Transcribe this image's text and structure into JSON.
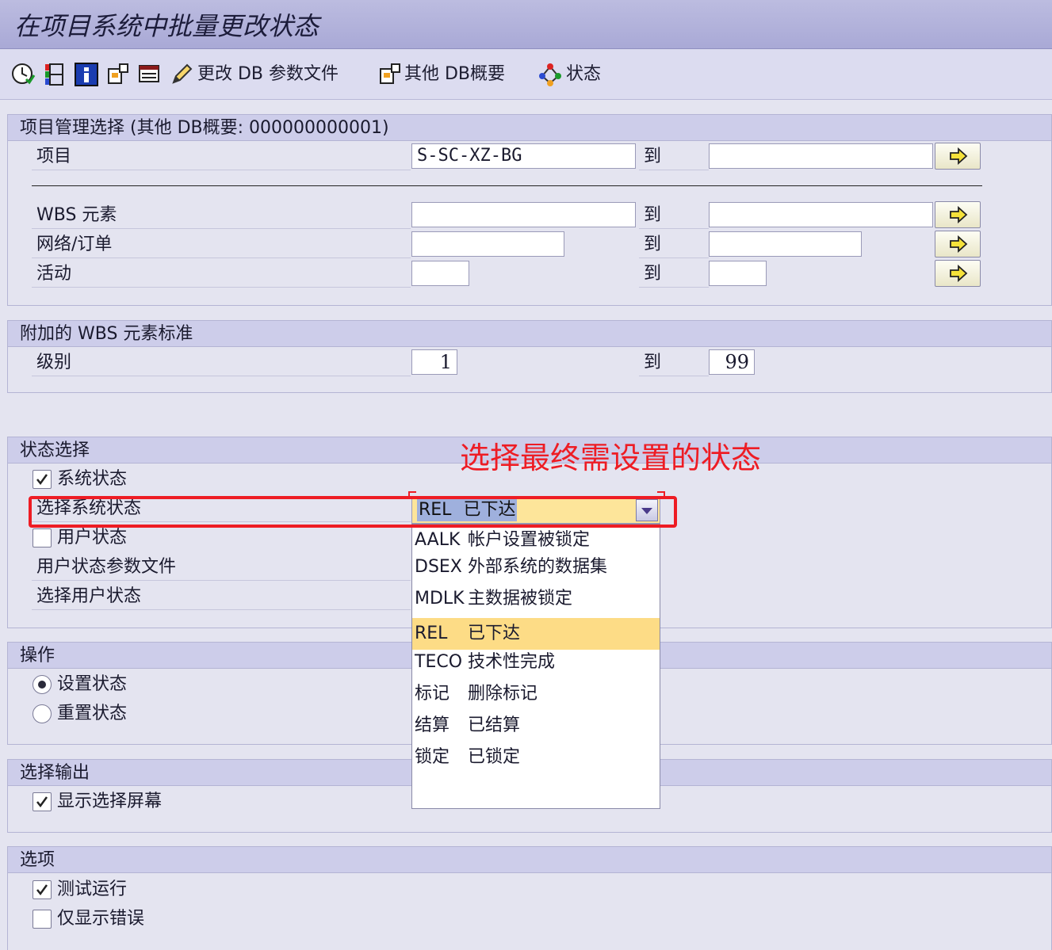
{
  "window": {
    "title": "在项目系统中批量更改状态"
  },
  "toolbar": {
    "change_db_profile": "更改 DB 参数文件",
    "other_db_overview": "其他 DB概要",
    "status": "状态"
  },
  "selection_group": {
    "title": "项目管理选择 (其他 DB概要: 000000000001)",
    "project_label": "项目",
    "project_value": "S-SC-XZ-BG",
    "to_label": "到",
    "wbs_label": "WBS 元素",
    "network_label": "网络/订单",
    "activity_label": "活动"
  },
  "wbs_group": {
    "title": "附加的 WBS 元素标准",
    "level_label": "级别",
    "level_from": "1",
    "level_to": "99",
    "to_label": "到"
  },
  "status_group": {
    "title": "状态选择",
    "system_status_label": "系统状态",
    "system_status_checked": true,
    "select_system_status_label": "选择系统状态",
    "selected_code": "REL",
    "selected_desc": "已下达",
    "user_status_label": "用户状态",
    "user_status_checked": false,
    "user_status_profile_label": "用户状态参数文件",
    "select_user_status_label": "选择用户状态"
  },
  "dropdown": {
    "options": [
      {
        "code": "AALK",
        "desc": "帐户设置被锁定"
      },
      {
        "code": "DSEX",
        "desc": "外部系统的数据集"
      },
      {
        "code": "MDLK",
        "desc": "主数据被锁定"
      },
      {
        "code": "REL",
        "desc": "已下达",
        "selected": true
      },
      {
        "code": "TECO",
        "desc": "技术性完成"
      },
      {
        "code": "标记",
        "desc": "删除标记"
      },
      {
        "code": "结算",
        "desc": "已结算"
      },
      {
        "code": "锁定",
        "desc": "已锁定"
      }
    ]
  },
  "operation_group": {
    "title": "操作",
    "set_status_label": "设置状态",
    "reset_status_label": "重置状态",
    "selected": "set"
  },
  "output_group": {
    "title": "选择输出",
    "show_selection_screen_label": "显示选择屏幕",
    "show_selection_screen_checked": true
  },
  "options_group": {
    "title": "选项",
    "test_run_label": "测试运行",
    "test_run_checked": true,
    "errors_only_label": "仅显示错误",
    "errors_only_checked": false
  },
  "annotation": {
    "text": "选择最终需设置的状态",
    "color": "#ee1c24"
  },
  "colors": {
    "title_bar": "#a9a9d6",
    "group_header": "#cdcdea",
    "dropdown_selected": "#fddc86",
    "annotation_red": "#ee1c24"
  }
}
